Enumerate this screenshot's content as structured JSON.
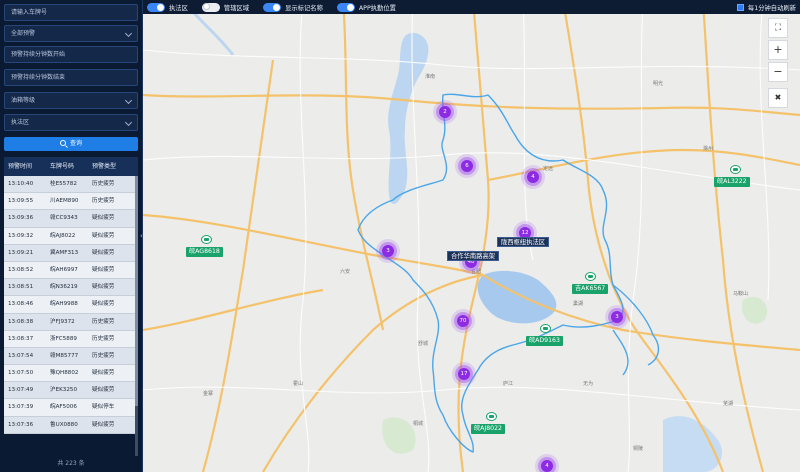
{
  "sidebar": {
    "plate_input": {
      "placeholder": "请输入车牌号"
    },
    "alarm_type_select": "全部预警",
    "duration_min": {
      "placeholder": "预警持续分钟数开始"
    },
    "duration_max": {
      "placeholder": "预警持续分钟数结束"
    },
    "level_select": "油箱等级",
    "zone_select": "执法区",
    "query_label": "查询",
    "table": {
      "headers": [
        "预警时间",
        "车牌号码",
        "预警类型"
      ],
      "rows": [
        [
          "13:10:40",
          "桂E55782",
          "历史疲劳"
        ],
        [
          "13:09:55",
          "川AEM890",
          "历史疲劳"
        ],
        [
          "13:09:36",
          "赣CC9343",
          "疑似疲劳"
        ],
        [
          "13:09:32",
          "皖AJ8022",
          "疑似疲劳"
        ],
        [
          "13:09:21",
          "冀AMF313",
          "疑似疲劳"
        ],
        [
          "13:08:52",
          "皖AH6997",
          "疑似疲劳"
        ],
        [
          "13:08:51",
          "皖N36219",
          "疑似疲劳"
        ],
        [
          "13:08:46",
          "皖AH9988",
          "疑似疲劳"
        ],
        [
          "13:08:38",
          "沪FJ9372",
          "历史疲劳"
        ],
        [
          "13:08:37",
          "浙FC5889",
          "历史疲劳"
        ],
        [
          "13:07:54",
          "赣M85777",
          "历史疲劳"
        ],
        [
          "13:07:50",
          "豫QH8802",
          "疑似疲劳"
        ],
        [
          "13:07:49",
          "沪EK3250",
          "疑似疲劳"
        ],
        [
          "13:07:39",
          "皖AF5006",
          "疑似停车"
        ],
        [
          "13:07:36",
          "鲁UX0880",
          "疑似疲劳"
        ]
      ]
    },
    "total": "共 223 条"
  },
  "topbar": {
    "toggles": [
      {
        "label": "执法区",
        "on": true
      },
      {
        "label": "管辖区域",
        "on": false
      },
      {
        "label": "显示标记名称",
        "on": true
      },
      {
        "label": "APP执勤位置",
        "on": true
      }
    ],
    "auto_refresh": "每1分钟自动刷新"
  },
  "map": {
    "place_labels": [
      "淮南",
      "六安",
      "合肥",
      "巢湖",
      "滁州",
      "马鞍山",
      "芜湖",
      "铜陵",
      "桐城",
      "舒城",
      "定远",
      "明光",
      "金寨",
      "霍山",
      "庐江",
      "无为"
    ],
    "clusters": [
      "2",
      "6",
      "4",
      "12",
      "3",
      "48",
      "70",
      "3",
      "17",
      "4"
    ],
    "vehicles": [
      "皖AL3222",
      "皖AG8618",
      "吉AK6567",
      "皖AD9163",
      "皖AJ8022"
    ],
    "dark_tags": [
      "陇西枢纽执法区",
      "合作华南路高架"
    ],
    "colors": {
      "boundary": "#4ba6e8",
      "cluster": "#8c2be3",
      "vehicle": "#19a36a"
    }
  },
  "controls": {
    "fullscreen": "⛶",
    "zoom_in": "+",
    "zoom_out": "−",
    "tools": "✖"
  }
}
